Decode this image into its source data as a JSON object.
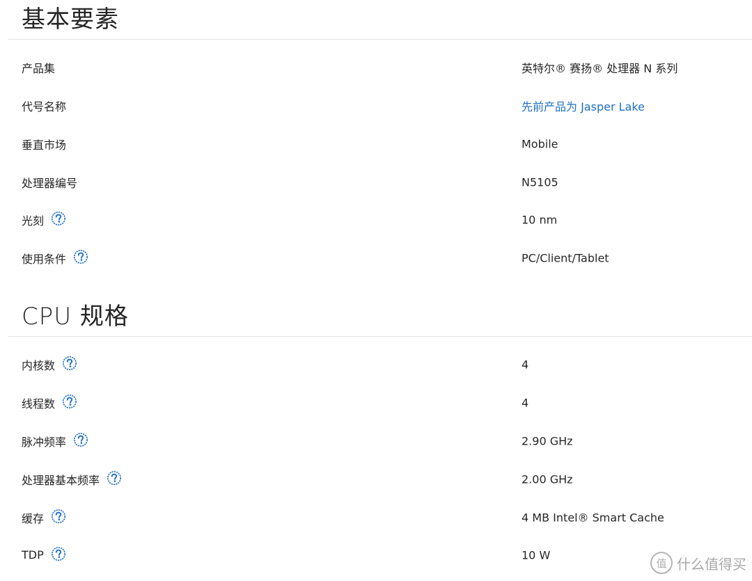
{
  "sections": [
    {
      "title": "基本要素",
      "rows": [
        {
          "label": "产品集",
          "value": "英特尔® 赛扬® 处理器 N 系列",
          "help": false,
          "link": false
        },
        {
          "label": "代号名称",
          "value": "先前产品为 Jasper Lake",
          "help": false,
          "link": true
        },
        {
          "label": "垂直市场",
          "value": "Mobile",
          "help": false,
          "link": false
        },
        {
          "label": "处理器编号",
          "value": "N5105",
          "help": false,
          "link": false
        },
        {
          "label": "光刻",
          "value": "10 nm",
          "help": true,
          "link": false
        },
        {
          "label": "使用条件",
          "value": "PC/Client/Tablet",
          "help": true,
          "link": false
        }
      ]
    },
    {
      "title": "CPU 规格",
      "rows": [
        {
          "label": "内核数",
          "value": "4",
          "help": true,
          "link": false
        },
        {
          "label": "线程数",
          "value": "4",
          "help": true,
          "link": false
        },
        {
          "label": "脉冲频率",
          "value": "2.90 GHz",
          "help": true,
          "link": false
        },
        {
          "label": "处理器基本频率",
          "value": "2.00 GHz",
          "help": true,
          "link": false
        },
        {
          "label": "缓存",
          "value": "4 MB Intel® Smart Cache",
          "help": true,
          "link": false
        },
        {
          "label": "TDP",
          "value": "10 W",
          "help": true,
          "link": false
        }
      ]
    }
  ],
  "icons": {
    "help": "question-circle-icon"
  },
  "colors": {
    "link": "#1e6fc4",
    "help_icon": "#1e6fc4",
    "divider": "#e3e3e3",
    "text": "#262626"
  },
  "watermark": {
    "badge": "值",
    "text": "什么值得买"
  }
}
